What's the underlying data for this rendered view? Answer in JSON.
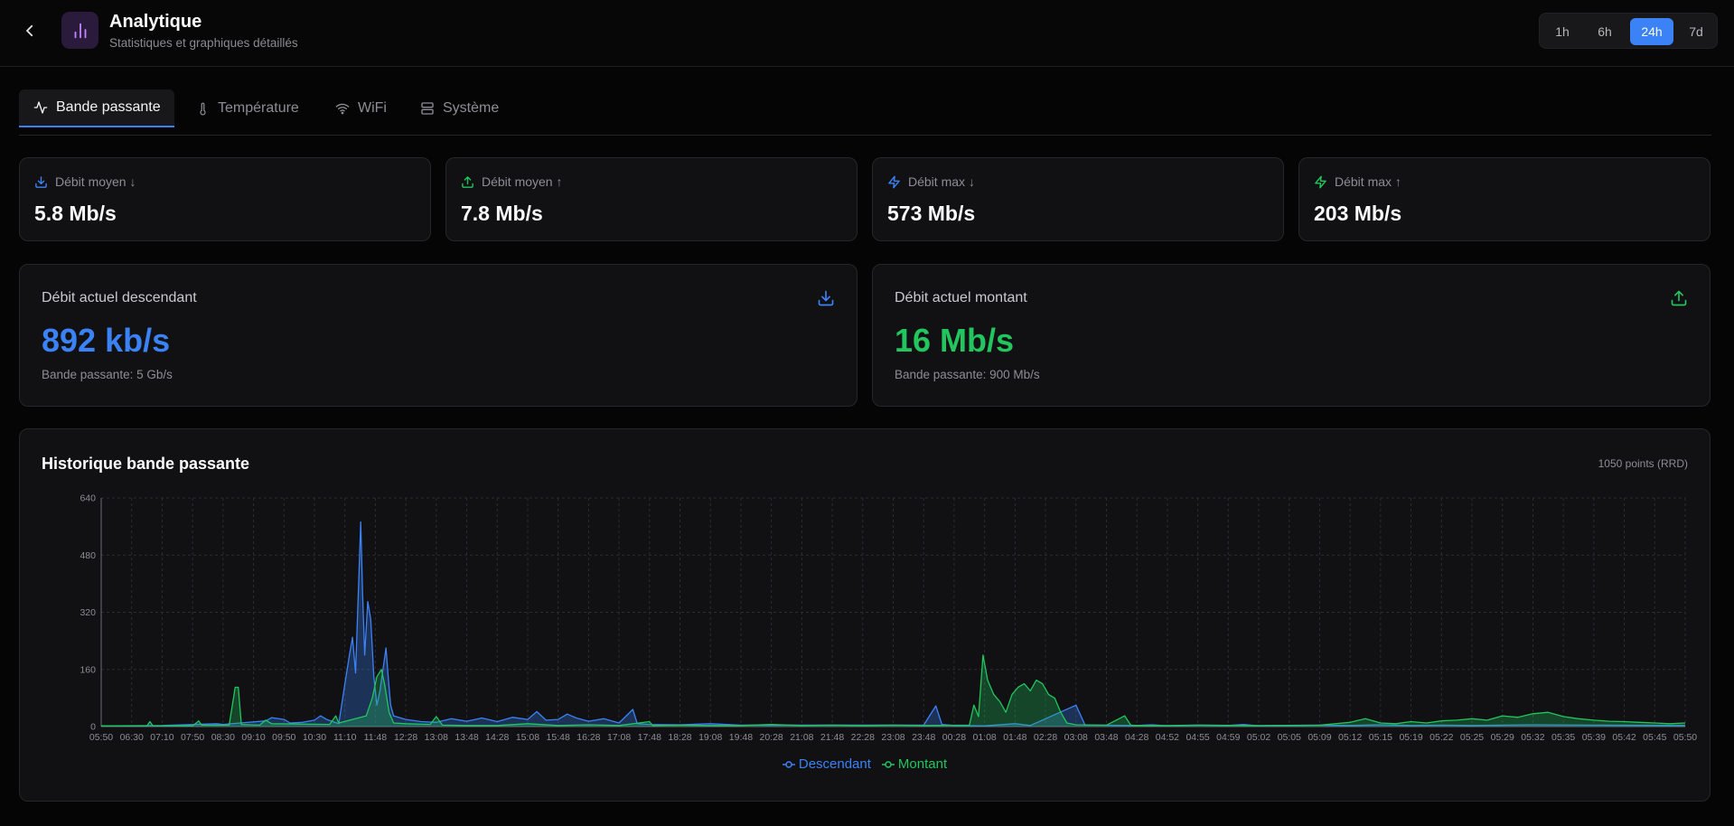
{
  "header": {
    "title": "Analytique",
    "subtitle": "Statistiques et graphiques détaillés",
    "ranges": [
      "1h",
      "6h",
      "24h",
      "7d"
    ],
    "active_range": "24h"
  },
  "tabs": [
    {
      "label": "Bande passante",
      "icon": "activity-icon",
      "active": true
    },
    {
      "label": "Température",
      "icon": "thermometer-icon",
      "active": false
    },
    {
      "label": "WiFi",
      "icon": "wifi-icon",
      "active": false
    },
    {
      "label": "Système",
      "icon": "server-icon",
      "active": false
    }
  ],
  "stats": [
    {
      "label": "Débit moyen ↓",
      "value": "5.8 Mb/s",
      "icon": "download-icon",
      "color": "#3b82f6"
    },
    {
      "label": "Débit moyen ↑",
      "value": "7.8 Mb/s",
      "icon": "upload-icon",
      "color": "#22c55e"
    },
    {
      "label": "Débit max ↓",
      "value": "573 Mb/s",
      "icon": "zap-icon",
      "color": "#3b82f6"
    },
    {
      "label": "Débit max ↑",
      "value": "203 Mb/s",
      "icon": "zap-icon",
      "color": "#22c55e"
    }
  ],
  "current": {
    "down": {
      "label": "Débit actuel descendant",
      "value": "892 kb/s",
      "sub": "Bande passante: 5 Gb/s",
      "color": "#3b82f6",
      "icon": "download-icon"
    },
    "up": {
      "label": "Débit actuel montant",
      "value": "16 Mb/s",
      "sub": "Bande passante: 900 Mb/s",
      "color": "#22c55e",
      "icon": "upload-icon"
    }
  },
  "history": {
    "title": "Historique bande passante",
    "meta": "1050 points (RRD)"
  },
  "chart_data": {
    "type": "area",
    "title": "Historique bande passante",
    "ylim": [
      0,
      640
    ],
    "yticks": [
      0,
      160,
      320,
      480,
      640
    ],
    "grid": true,
    "legend_position": "bottom-center",
    "x_tick_labels": [
      "05:50",
      "06:30",
      "07:10",
      "07:50",
      "08:30",
      "09:10",
      "09:50",
      "10:30",
      "11:10",
      "11:48",
      "12:28",
      "13:08",
      "13:48",
      "14:28",
      "15:08",
      "15:48",
      "16:28",
      "17:08",
      "17:48",
      "18:28",
      "19:08",
      "19:48",
      "20:28",
      "21:08",
      "21:48",
      "22:28",
      "23:08",
      "23:48",
      "00:28",
      "01:08",
      "01:48",
      "02:28",
      "03:08",
      "03:48",
      "04:28",
      "04:52",
      "04:55",
      "04:59",
      "05:02",
      "05:05",
      "05:09",
      "05:12",
      "05:15",
      "05:19",
      "05:22",
      "05:25",
      "05:29",
      "05:32",
      "05:35",
      "05:39",
      "05:42",
      "05:45",
      "05:50"
    ],
    "series": [
      {
        "name": "Descendant",
        "color": "#3b82f6",
        "points": [
          [
            0,
            2
          ],
          [
            2,
            3
          ],
          [
            3.8,
            8
          ],
          [
            4,
            6
          ],
          [
            5.4,
            16
          ],
          [
            5.6,
            25
          ],
          [
            6.0,
            20
          ],
          [
            6.2,
            10
          ],
          [
            6.6,
            12
          ],
          [
            7.0,
            18
          ],
          [
            7.2,
            30
          ],
          [
            7.4,
            20
          ],
          [
            7.8,
            8
          ],
          [
            8.0,
            120
          ],
          [
            8.15,
            200
          ],
          [
            8.25,
            250
          ],
          [
            8.35,
            150
          ],
          [
            8.45,
            400
          ],
          [
            8.52,
            573
          ],
          [
            8.58,
            380
          ],
          [
            8.65,
            200
          ],
          [
            8.75,
            350
          ],
          [
            8.85,
            300
          ],
          [
            8.95,
            140
          ],
          [
            9.05,
            60
          ],
          [
            9.15,
            100
          ],
          [
            9.25,
            160
          ],
          [
            9.35,
            220
          ],
          [
            9.42,
            140
          ],
          [
            9.5,
            60
          ],
          [
            9.6,
            30
          ],
          [
            10.0,
            20
          ],
          [
            10.5,
            14
          ],
          [
            11.0,
            12
          ],
          [
            11.5,
            22
          ],
          [
            12.0,
            15
          ],
          [
            12.5,
            24
          ],
          [
            13.0,
            14
          ],
          [
            13.5,
            26
          ],
          [
            14.0,
            20
          ],
          [
            14.3,
            42
          ],
          [
            14.6,
            18
          ],
          [
            15.0,
            20
          ],
          [
            15.3,
            35
          ],
          [
            15.6,
            24
          ],
          [
            16.0,
            15
          ],
          [
            16.5,
            22
          ],
          [
            17.0,
            10
          ],
          [
            17.45,
            48
          ],
          [
            17.6,
            8
          ],
          [
            18.0,
            6
          ],
          [
            19.0,
            5
          ],
          [
            20.0,
            8
          ],
          [
            21.0,
            4
          ],
          [
            27.0,
            4
          ],
          [
            27.4,
            58
          ],
          [
            27.6,
            6
          ],
          [
            28.0,
            3
          ],
          [
            29.0,
            2
          ],
          [
            30.0,
            8
          ],
          [
            30.5,
            3
          ],
          [
            32.0,
            60
          ],
          [
            32.3,
            4
          ],
          [
            34.0,
            3
          ],
          [
            34.5,
            5
          ],
          [
            35.0,
            2
          ],
          [
            36.0,
            4
          ],
          [
            37.0,
            3
          ],
          [
            37.5,
            6
          ],
          [
            38.0,
            2
          ],
          [
            39.0,
            3
          ],
          [
            40.0,
            4
          ],
          [
            41.0,
            3
          ],
          [
            42.0,
            5
          ],
          [
            43.0,
            3
          ],
          [
            44.0,
            4
          ],
          [
            45.0,
            3
          ],
          [
            47.0,
            5
          ],
          [
            49.0,
            4
          ],
          [
            52.0,
            3
          ]
        ]
      },
      {
        "name": "Montant",
        "color": "#22c55e",
        "points": [
          [
            0,
            2
          ],
          [
            1.5,
            2
          ],
          [
            1.6,
            14
          ],
          [
            1.7,
            2
          ],
          [
            3.0,
            2
          ],
          [
            3.2,
            16
          ],
          [
            3.3,
            4
          ],
          [
            4.2,
            4
          ],
          [
            4.4,
            110
          ],
          [
            4.5,
            110
          ],
          [
            4.6,
            6
          ],
          [
            5.2,
            4
          ],
          [
            5.4,
            18
          ],
          [
            5.6,
            8
          ],
          [
            7.5,
            6
          ],
          [
            7.7,
            30
          ],
          [
            7.8,
            10
          ],
          [
            8.7,
            30
          ],
          [
            8.9,
            80
          ],
          [
            9.05,
            140
          ],
          [
            9.2,
            160
          ],
          [
            9.3,
            120
          ],
          [
            9.45,
            40
          ],
          [
            9.6,
            10
          ],
          [
            10.0,
            8
          ],
          [
            10.8,
            6
          ],
          [
            11.0,
            28
          ],
          [
            11.2,
            4
          ],
          [
            12.0,
            3
          ],
          [
            13.0,
            3
          ],
          [
            14.0,
            8
          ],
          [
            15.0,
            3
          ],
          [
            16.0,
            5
          ],
          [
            17.0,
            3
          ],
          [
            18.0,
            14
          ],
          [
            18.1,
            3
          ],
          [
            19.0,
            4
          ],
          [
            20.0,
            3
          ],
          [
            21.0,
            3
          ],
          [
            22.0,
            6
          ],
          [
            23.0,
            3
          ],
          [
            24.0,
            4
          ],
          [
            25.0,
            3
          ],
          [
            26.0,
            4
          ],
          [
            27.0,
            3
          ],
          [
            28.5,
            4
          ],
          [
            28.65,
            60
          ],
          [
            28.8,
            28
          ],
          [
            28.95,
            200
          ],
          [
            29.1,
            130
          ],
          [
            29.3,
            90
          ],
          [
            29.5,
            70
          ],
          [
            29.7,
            40
          ],
          [
            29.9,
            90
          ],
          [
            30.1,
            110
          ],
          [
            30.3,
            120
          ],
          [
            30.5,
            100
          ],
          [
            30.7,
            130
          ],
          [
            30.9,
            120
          ],
          [
            31.1,
            90
          ],
          [
            31.3,
            80
          ],
          [
            31.5,
            40
          ],
          [
            31.7,
            10
          ],
          [
            32.0,
            5
          ],
          [
            33.0,
            4
          ],
          [
            33.6,
            30
          ],
          [
            33.8,
            4
          ],
          [
            34.0,
            3
          ],
          [
            35.0,
            3
          ],
          [
            36.0,
            4
          ],
          [
            38.0,
            3
          ],
          [
            40.0,
            4
          ],
          [
            41.0,
            12
          ],
          [
            41.5,
            22
          ],
          [
            42.0,
            10
          ],
          [
            42.5,
            8
          ],
          [
            43.0,
            14
          ],
          [
            43.5,
            10
          ],
          [
            44.0,
            16
          ],
          [
            44.5,
            18
          ],
          [
            45.0,
            22
          ],
          [
            45.5,
            18
          ],
          [
            46.0,
            30
          ],
          [
            46.5,
            26
          ],
          [
            47.0,
            36
          ],
          [
            47.5,
            40
          ],
          [
            48.0,
            28
          ],
          [
            48.5,
            22
          ],
          [
            49.0,
            18
          ],
          [
            49.5,
            15
          ],
          [
            50.0,
            14
          ],
          [
            50.5,
            12
          ],
          [
            51.0,
            10
          ],
          [
            51.5,
            8
          ],
          [
            52.0,
            10
          ]
        ]
      }
    ]
  }
}
